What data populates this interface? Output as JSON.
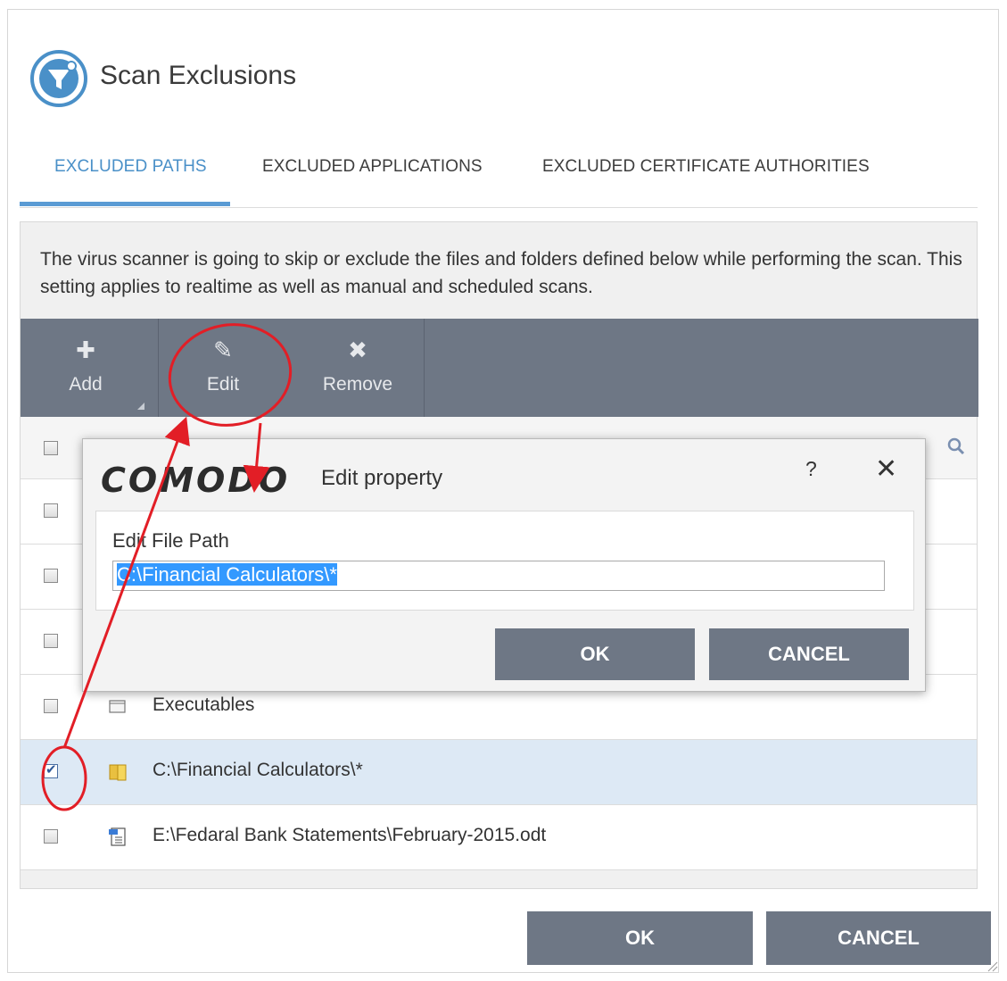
{
  "window": {
    "title": "Scan Exclusions"
  },
  "tabs": [
    {
      "label": "EXCLUDED PATHS",
      "active": true
    },
    {
      "label": "EXCLUDED APPLICATIONS",
      "active": false
    },
    {
      "label": "EXCLUDED CERTIFICATE AUTHORITIES",
      "active": false
    }
  ],
  "description": "The virus scanner is going to skip or exclude the files and folders defined below while performing the scan. This setting applies to realtime as well as manual and scheduled scans.",
  "toolbar": {
    "add_label": "Add",
    "edit_label": "Edit",
    "remove_label": "Remove"
  },
  "rows": [
    {
      "label": "",
      "checked": false,
      "icon": "none"
    },
    {
      "label": "",
      "checked": false,
      "icon": "none"
    },
    {
      "label": "",
      "checked": false,
      "icon": "none"
    },
    {
      "label": "Executables",
      "checked": false,
      "icon": "group-icon"
    },
    {
      "label": "C:\\Financial Calculators\\*",
      "checked": true,
      "icon": "folder-icon"
    },
    {
      "label": "E:\\Fedaral Bank Statements\\February-2015.odt",
      "checked": false,
      "icon": "document-icon"
    }
  ],
  "footer": {
    "ok_label": "OK",
    "cancel_label": "CANCEL"
  },
  "dialog": {
    "brand": "COMODO",
    "title": "Edit property",
    "help": "?",
    "close": "✕",
    "field_label": "Edit File Path",
    "field_value": "C:\\Financial Calculators\\*",
    "ok_label": "OK",
    "cancel_label": "CANCEL"
  },
  "colors": {
    "accent": "#5a9bd4",
    "toolbar": "#6e7785",
    "selected_row": "#dde9f5",
    "annotation": "#e21e26"
  }
}
